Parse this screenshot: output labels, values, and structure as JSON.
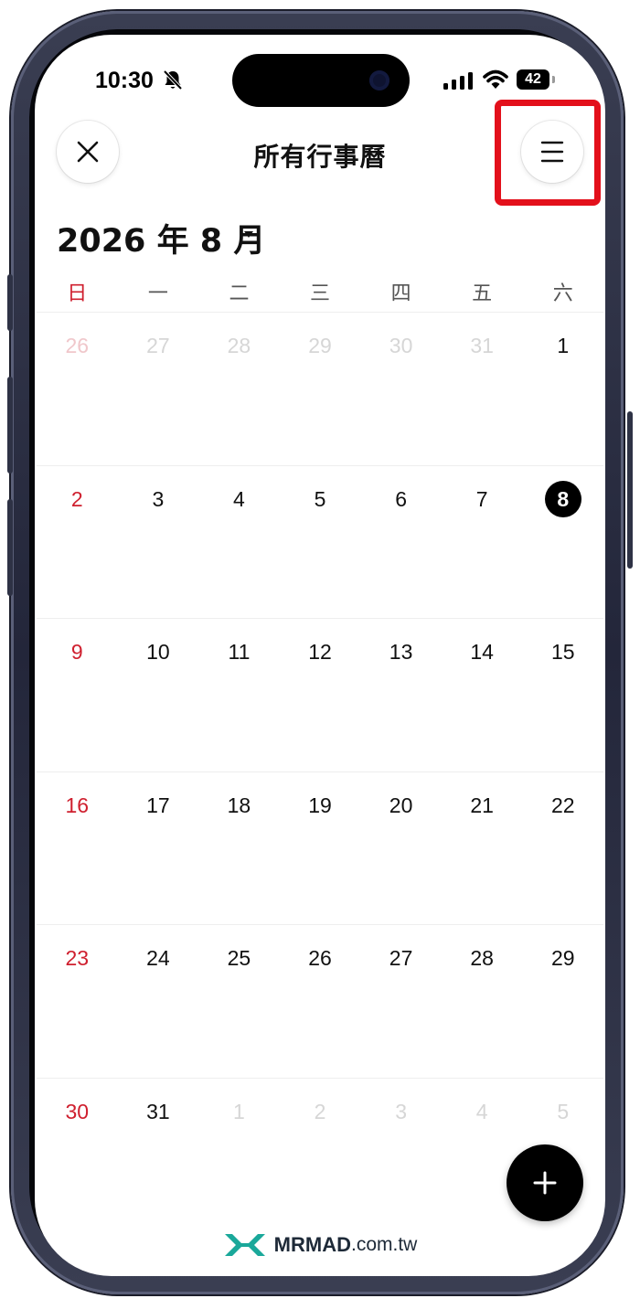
{
  "status_bar": {
    "time": "10:30",
    "battery": "42"
  },
  "header": {
    "title": "所有行事曆",
    "month_label": "2026 年 8 月"
  },
  "weekdays": [
    "日",
    "一",
    "二",
    "三",
    "四",
    "五",
    "六"
  ],
  "weeks": [
    [
      {
        "d": "26",
        "muted": true
      },
      {
        "d": "27",
        "muted": true
      },
      {
        "d": "28",
        "muted": true
      },
      {
        "d": "29",
        "muted": true
      },
      {
        "d": "30",
        "muted": true
      },
      {
        "d": "31",
        "muted": true
      },
      {
        "d": "1"
      }
    ],
    [
      {
        "d": "2"
      },
      {
        "d": "3"
      },
      {
        "d": "4"
      },
      {
        "d": "5"
      },
      {
        "d": "6"
      },
      {
        "d": "7"
      },
      {
        "d": "8",
        "today": true
      }
    ],
    [
      {
        "d": "9"
      },
      {
        "d": "10"
      },
      {
        "d": "11"
      },
      {
        "d": "12"
      },
      {
        "d": "13"
      },
      {
        "d": "14"
      },
      {
        "d": "15"
      }
    ],
    [
      {
        "d": "16"
      },
      {
        "d": "17"
      },
      {
        "d": "18"
      },
      {
        "d": "19"
      },
      {
        "d": "20"
      },
      {
        "d": "21"
      },
      {
        "d": "22"
      }
    ],
    [
      {
        "d": "23"
      },
      {
        "d": "24"
      },
      {
        "d": "25"
      },
      {
        "d": "26"
      },
      {
        "d": "27"
      },
      {
        "d": "28"
      },
      {
        "d": "29"
      }
    ],
    [
      {
        "d": "30"
      },
      {
        "d": "31"
      },
      {
        "d": "1",
        "muted": true
      },
      {
        "d": "2",
        "muted": true
      },
      {
        "d": "3",
        "muted": true
      },
      {
        "d": "4",
        "muted": true
      },
      {
        "d": "5",
        "muted": true
      }
    ]
  ],
  "watermark": {
    "brand": "MRMAD",
    "domain": ".com.tw"
  },
  "colors": {
    "sunday": "#cf1f2e",
    "highlight": "#e3101b",
    "today_bg": "#000000",
    "watermark_logo": "#1aa89a"
  },
  "icons": {
    "close": "close-icon",
    "menu": "hamburger-menu-icon",
    "add": "plus-icon",
    "caret": "caret-down-icon",
    "mute": "bell-slash-icon"
  }
}
